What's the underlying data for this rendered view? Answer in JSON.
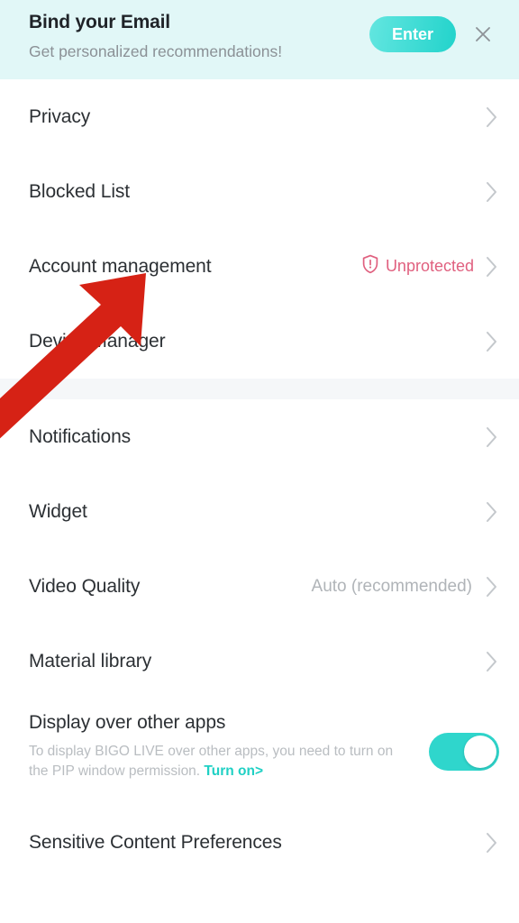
{
  "banner": {
    "title": "Bind your Email",
    "subtitle": "Get personalized recommendations!",
    "enter_label": "Enter",
    "close_icon": "close-icon",
    "background_color": "#e1f7f7",
    "accent_color": "#22d3cb"
  },
  "settings": {
    "group1": [
      {
        "label": "Privacy",
        "value": "",
        "chevron": true
      },
      {
        "label": "Blocked List",
        "value": "",
        "chevron": true
      },
      {
        "label": "Account management",
        "value": "",
        "badge": "Unprotected",
        "badge_icon": "shield-alert-icon",
        "badge_color": "#e0607f",
        "chevron": true
      },
      {
        "label": "Device Manager",
        "value": "",
        "chevron": true
      }
    ],
    "group2": [
      {
        "label": "Notifications",
        "value": "",
        "chevron": true
      },
      {
        "label": "Widget",
        "value": "",
        "chevron": true
      },
      {
        "label": "Video Quality",
        "value": "Auto (recommended)",
        "chevron": true
      },
      {
        "label": "Material library",
        "value": "",
        "chevron": true
      }
    ],
    "display_over_apps": {
      "label": "Display over other apps",
      "description": "To display BIGO LIVE over other apps, you need to turn on the PIP window permission. ",
      "link_label": "Turn on>",
      "toggle_state": "on",
      "toggle_color": "#2fd6cc"
    },
    "group3": [
      {
        "label": "Sensitive Content Preferences",
        "value": "",
        "chevron": true
      }
    ]
  },
  "annotation": {
    "arrow": "red-arrow-pointing-to-account-management",
    "color": "#d62215"
  }
}
